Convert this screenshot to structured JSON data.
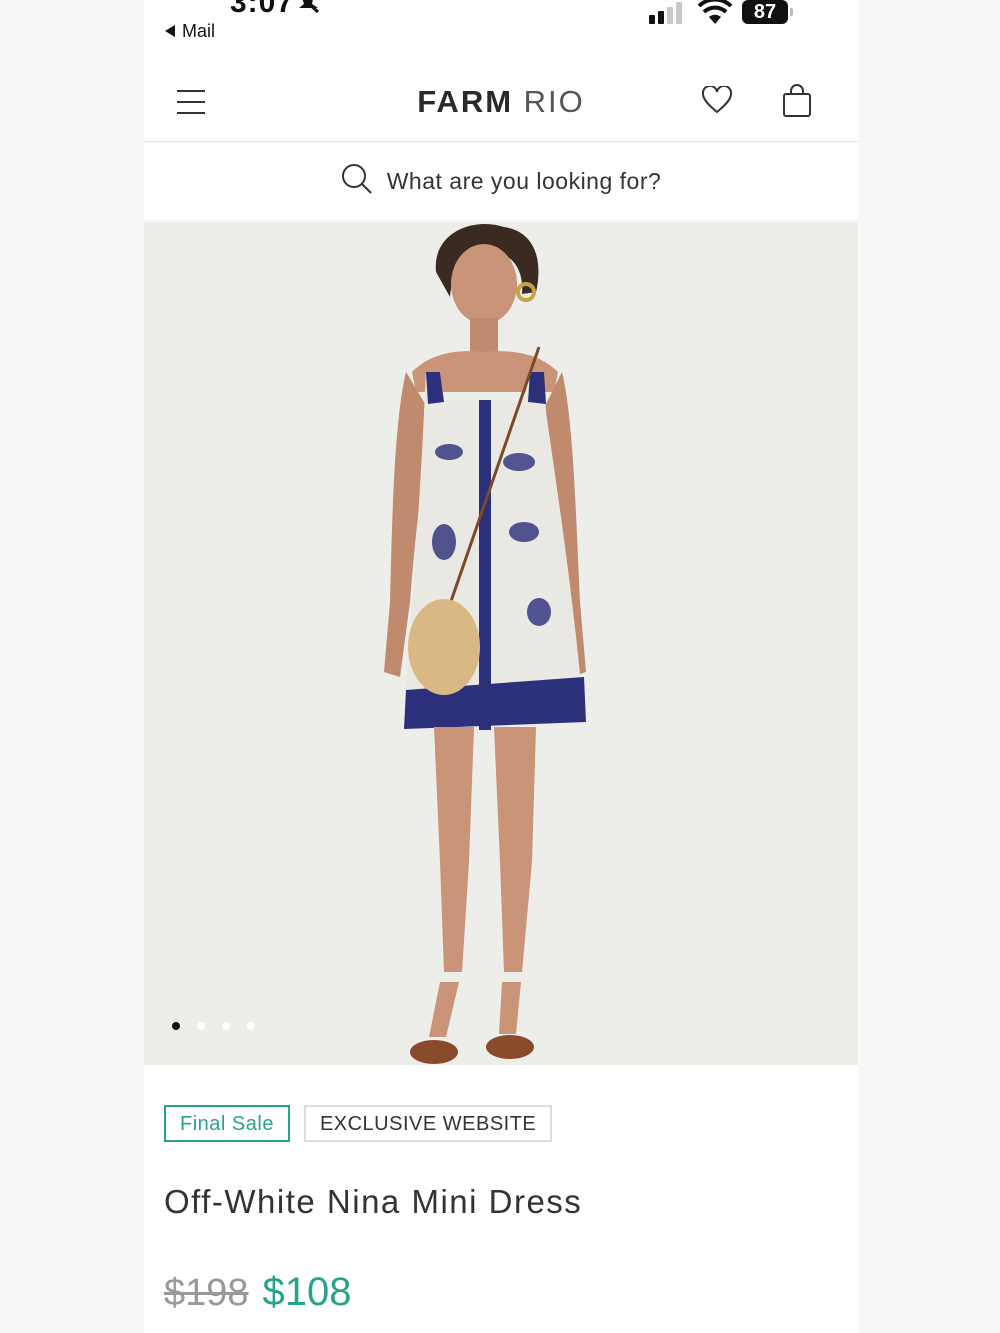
{
  "status_bar": {
    "time": "3:07",
    "back_label": "Mail",
    "battery": "87"
  },
  "header": {
    "logo_primary": "FARM",
    "logo_secondary": "RIO"
  },
  "search": {
    "placeholder": "What are you looking for?"
  },
  "gallery": {
    "image_count": 4,
    "active_index": 0
  },
  "product": {
    "badges": [
      "Final Sale",
      "EXCLUSIVE WEBSITE"
    ],
    "name": "Off-White Nina Mini Dress",
    "original_price": "$198",
    "sale_price": "$108"
  },
  "colors": {
    "accent": "#27a48b",
    "dress_navy": "#2c2f7a"
  },
  "icons": [
    "bell-muted-icon",
    "back-arrow-icon",
    "signal-icon",
    "wifi-icon",
    "menu-icon",
    "heart-icon",
    "bag-icon",
    "search-icon"
  ]
}
